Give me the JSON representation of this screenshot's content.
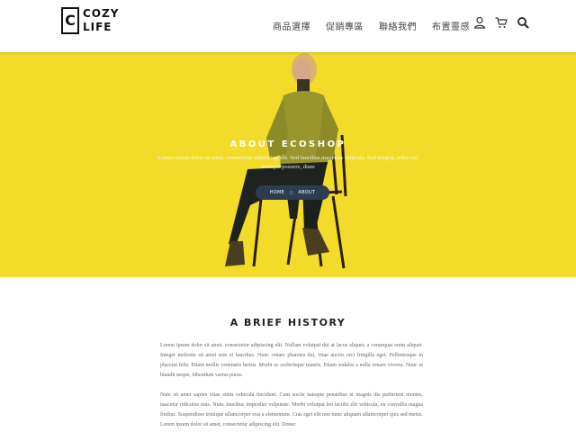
{
  "header": {
    "logo_letter": "C",
    "logo_line1": "COZY",
    "logo_line2": "LIFE",
    "nav": [
      "商品選擇",
      "促銷專區",
      "聯絡我們",
      "布置靈感"
    ],
    "icons": [
      "user-icon",
      "cart-icon",
      "search-icon"
    ]
  },
  "hero": {
    "title": "ABOUT ECOSHOP",
    "subtitle": "Lorem ipsum dolor sit amet, consectetur adipiscing elit. Sed faucibus maximus vehicula. Sed feugiat, tellus vel tristique posuere, diam",
    "breadcrumb_home": "HOME",
    "breadcrumb_sep": "⊙",
    "breadcrumb_current": "ABOUT",
    "background_color": "#f3db2a"
  },
  "history": {
    "title": "A BRIEF HISTORY",
    "paragraph1": "Lorem ipsum dolor sit amet, consectetur adipiscing elit. Nullam volutpat dui at lacus aliquet, a consequat enim aliquet. Integer molestie sit amet sem et faucibus. Nunc ornare pharetra dui, vitae auctor orci fringilla eget. Pellentesque in placerat felis. Etiam mollis venenatis luctus. Morbi ac scelerisque mauris. Etiam sodales a nulla ornare viverra. Nunc at blandit neque, bibendum varius purus.",
    "paragraph2": "Nam sit amet sapien vitae enim vehicula tincidunt. Cum sociis natoque penatibus et magnis dis parturient montes, nascetur ridiculus mus. Nunc faucibus imperdiet vulputate. Morbi volutpat leo iaculis elit vehicula, eu convallis magna finibus. Suspendisse tristique ullamcorper erat a elementum. Cras eget elit non nunc aliquam ullamcorper quis sed metus. Lorem ipsum dolor sit amet, consectetur adipiscing elit. Donec"
  }
}
